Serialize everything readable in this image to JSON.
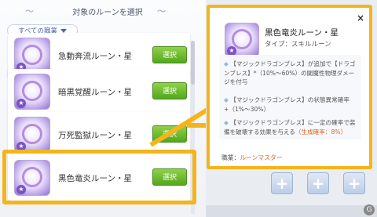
{
  "header": {
    "title": "対象のルーンを選択"
  },
  "filter": {
    "label": "すべての職業"
  },
  "runes": [
    {
      "name": "急動奔流ルーン・星",
      "button": "選択"
    },
    {
      "name": "暗黒覚醒ルーン・星",
      "button": "選択"
    },
    {
      "name": "万死監獄ルーン・星",
      "button": "選択"
    },
    {
      "name": "黒色竜炎ルーン・星",
      "button": "選択"
    }
  ],
  "star_badge": "★",
  "detail": {
    "name": "黒色竜炎ルーン・星",
    "type": "タイプ：スキルルーン",
    "close": "×",
    "bullet": "◆",
    "line1": "【マジックドラゴンブレス】が追加で【ドラゴンブレス】*（10%〜60%）の閾魔性物理ダメージを付与",
    "line2": "【マジックドラゴンブレス】の状態異常確率+（1%〜30%）",
    "line3a": "【マジックドラゴンブレス】に一定の確率で装備を破壊する効果を与える",
    "line3b": "（生成確率：8%）",
    "job_label": "職業：",
    "job_value": "ルーンマスター"
  },
  "plus": "+",
  "watermark": "G",
  "accent_color": "#f4b41b",
  "button_color": "#53a71d"
}
